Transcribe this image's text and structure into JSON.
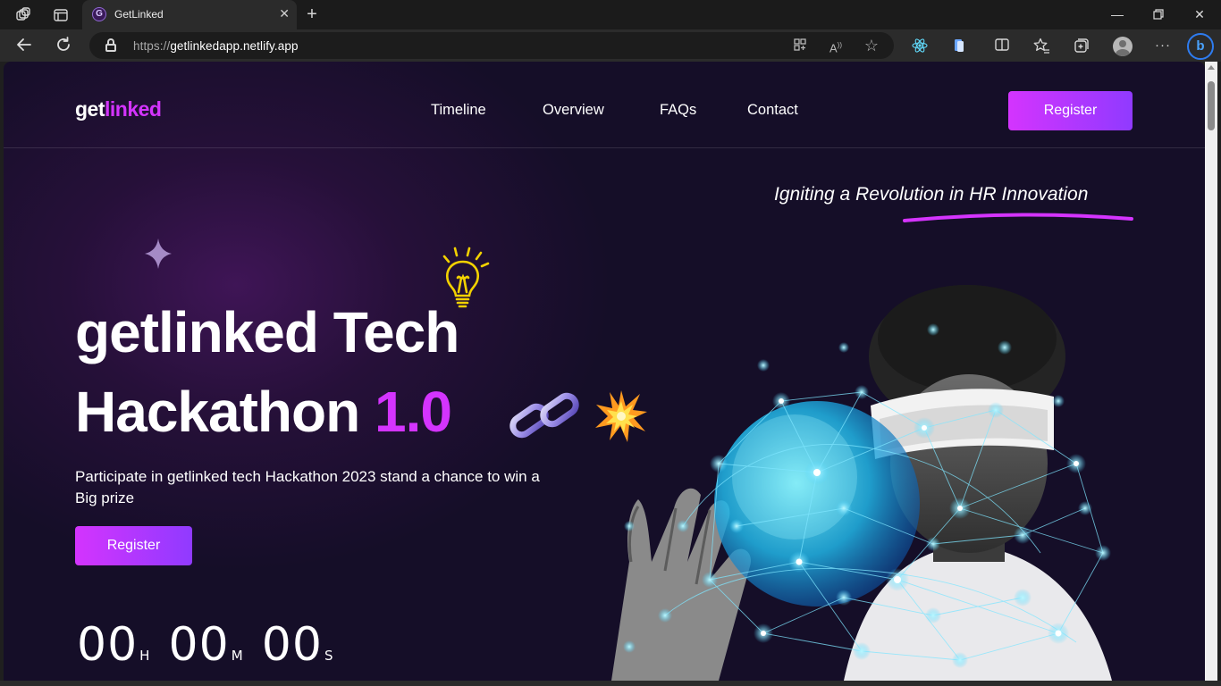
{
  "browser": {
    "tab_title": "GetLinked",
    "tab_favicon": "G",
    "url_scheme": "https://",
    "url_host": "getlinkedapp.netlify.app",
    "bing_label": "b"
  },
  "site": {
    "logo_part1": "get",
    "logo_part2": "linked",
    "nav": [
      {
        "label": "Timeline"
      },
      {
        "label": "Overview"
      },
      {
        "label": "FAQs"
      },
      {
        "label": "Contact"
      }
    ],
    "header_register": "Register"
  },
  "hero": {
    "tagline": "Igniting a Revolution in HR Innovation",
    "title_line1": "getlinked Tech",
    "title_line2_word": "Hackathon",
    "title_line2_accent": "1.0",
    "description": "Participate in getlinked tech Hackathon 2023 stand a chance to win a Big prize",
    "register": "Register",
    "countdown": {
      "hours": "00",
      "hours_unit": "H",
      "minutes": "00",
      "minutes_unit": "M",
      "seconds": "00",
      "seconds_unit": "S"
    }
  },
  "colors": {
    "accent_pink": "#d434fe",
    "accent_purple": "#903aff",
    "bg_dark": "#150e28"
  }
}
